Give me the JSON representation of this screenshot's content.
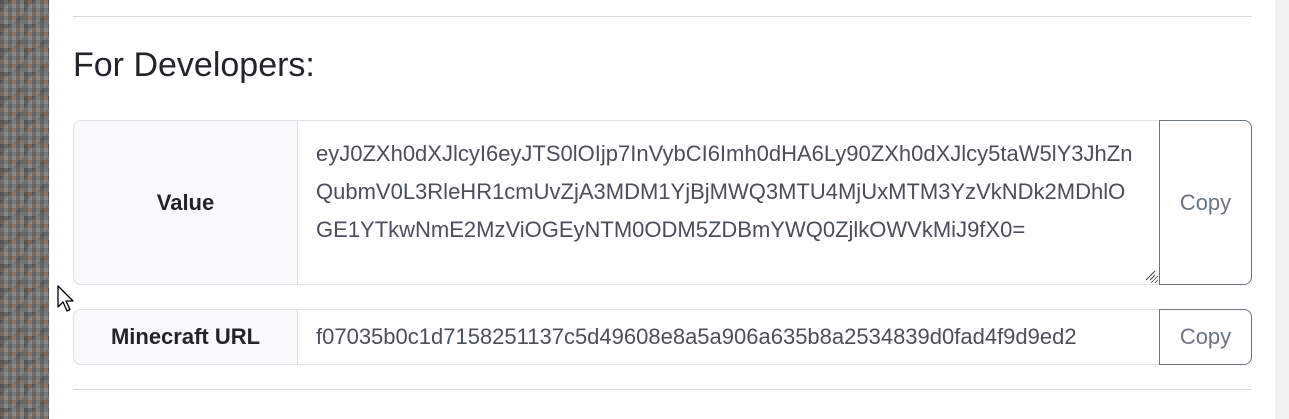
{
  "section": {
    "heading": "For Developers:"
  },
  "value_row": {
    "label": "Value",
    "value": "eyJ0ZXh0dXJlcyI6eyJTS0lOIjp7InVybCI6Imh0dHA6Ly90ZXh0dXJlcy5taW5lY3JhZnQubmV0L3RleHR1cmUvZjA3MDM1YjBjMWQ3MTU4MjUxMTM3YzVkNDk2MDhlOGE1YTkwNmE2MzViOGEyNTM0ODM5ZDBmYWQ0ZjlkOWVkMiJ9fX0=",
    "copy_label": "Copy"
  },
  "url_row": {
    "label": "Minecraft URL",
    "value": "f07035b0c1d7158251137c5d49608e8a5a906a635b8a2534839d0fad4f9d9ed2",
    "copy_label": "Copy"
  },
  "icons": {
    "cursor": "mouse-pointer-icon",
    "resize": "resize-grip-icon"
  }
}
